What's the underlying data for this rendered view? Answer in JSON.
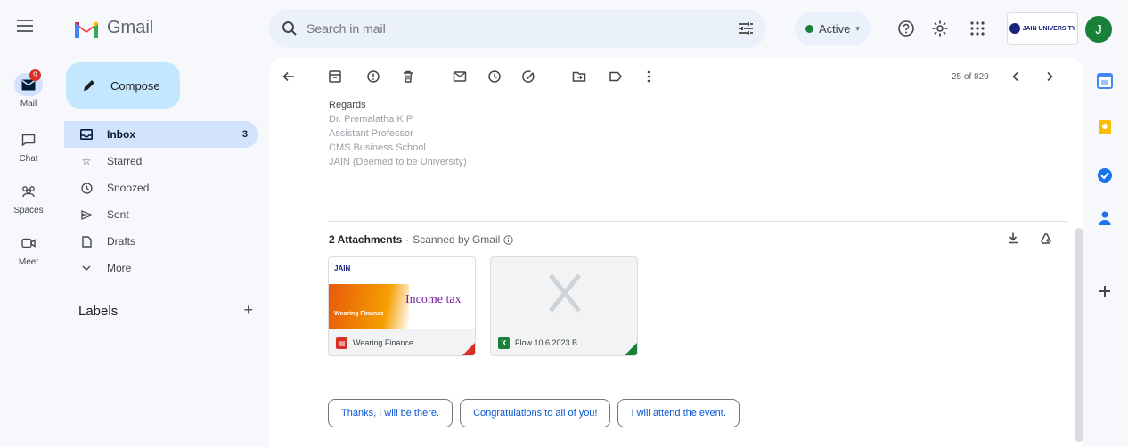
{
  "app": {
    "name": "Gmail"
  },
  "search": {
    "placeholder": "Search in mail"
  },
  "status": {
    "label": "Active"
  },
  "account": {
    "initial": "J",
    "org_label": "JAIN UNIVERSITY"
  },
  "rail": [
    {
      "label": "Mail",
      "badge": "9"
    },
    {
      "label": "Chat"
    },
    {
      "label": "Spaces"
    },
    {
      "label": "Meet"
    }
  ],
  "compose_label": "Compose",
  "nav": [
    {
      "label": "Inbox",
      "count": "3"
    },
    {
      "label": "Starred"
    },
    {
      "label": "Snoozed"
    },
    {
      "label": "Sent"
    },
    {
      "label": "Drafts"
    },
    {
      "label": "More"
    }
  ],
  "labels_heading": "Labels",
  "pager": "25 of 829",
  "signature": [
    "Regards",
    "Dr. Premalatha K P",
    "Assistant Professor",
    "CMS Business School",
    "JAIN (Deemed to be University)"
  ],
  "attachments": {
    "count_label": "2 Attachments",
    "scanned_label": "Scanned by Gmail",
    "items": [
      {
        "name": "Wearing Finance ...",
        "type": "pdf",
        "thumb_brand": "JAIN",
        "thumb_text": "Income tax",
        "thumb_banner": "Wearing Finance"
      },
      {
        "name": "Flow 10.6.2023 B...",
        "type": "xlsx"
      }
    ]
  },
  "smart_replies": [
    "Thanks, I will be there.",
    "Congratulations to all of you!",
    "I will attend the event."
  ],
  "colors": {
    "accent": "#0b57d0",
    "compose_bg": "#c2e7ff",
    "selected_bg": "#d3e3fd",
    "active_green": "#188038",
    "badge_red": "#d93025"
  }
}
